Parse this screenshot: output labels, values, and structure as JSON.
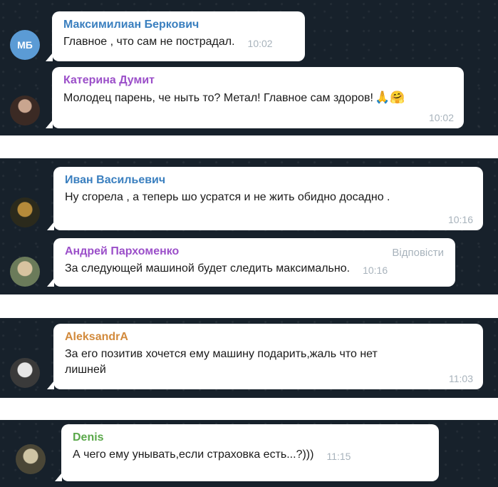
{
  "messages": [
    {
      "author": "Максимилиан Беркович",
      "text": "Главное , что сам не пострадал.",
      "time": "10:02",
      "avatar_initials": "МБ",
      "name_color": "#3a7fbf"
    },
    {
      "author": "Катерина Думит",
      "text": "Молодец парень, че ныть то? Метал! Главное сам здоров!",
      "emoji": "🙏🤗",
      "time": "10:02",
      "name_color": "#9b4fc9"
    },
    {
      "author": "Иван Васильевич",
      "text": "Ну сгорела , а теперь шо усратся и не жить обидно досадно .",
      "time": "10:16",
      "name_color": "#3a7fbf"
    },
    {
      "author": "Андрей Пархоменко",
      "text": "За следующей машиной будет следить максимально.",
      "time": "10:16",
      "reply": "Відповісти",
      "name_color": "#9b4fc9"
    },
    {
      "author": "AleksandrA",
      "text_line1": "За его позитив хочется ему машину подарить,жаль что нет",
      "text_line2": "лишней",
      "time": "11:03",
      "name_color": "#d28a3c"
    },
    {
      "author": "Denis",
      "text": "А чего ему унывать,если страховка есть...?)))",
      "time": "11:15",
      "name_color": "#5aa84a"
    }
  ]
}
